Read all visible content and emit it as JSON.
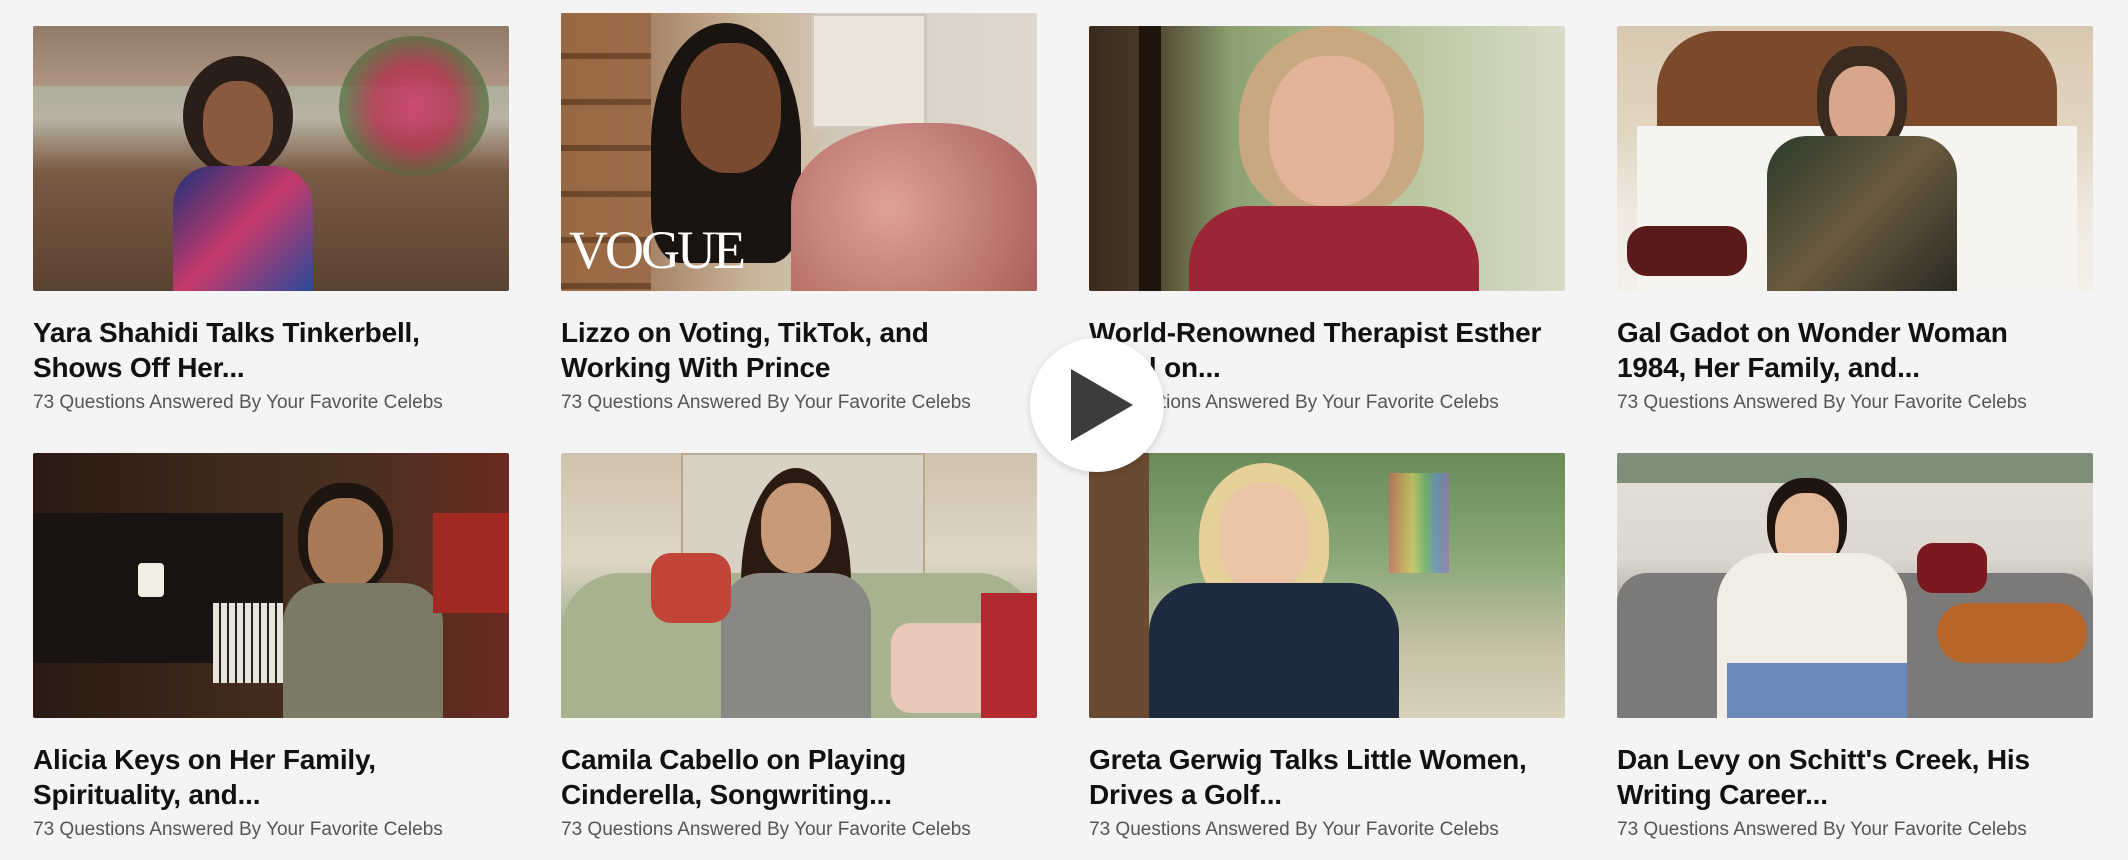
{
  "videos": [
    {
      "title_line1": "Yara Shahidi Talks Tinkerbell,",
      "title_line2": "Shows Off Her...",
      "series": "73 Questions Answered By Your Favorite Celebs"
    },
    {
      "title_line1": "Lizzo on Voting, TikTok, and",
      "title_line2": "Working With Prince",
      "series": "73 Questions Answered By Your Favorite Celebs",
      "brand": "VOGUE"
    },
    {
      "title_line1": "World-Renowned Therapist Esther",
      "title_line2": "Perel on...",
      "series": "73 Questions Answered By Your Favorite Celebs"
    },
    {
      "title_line1": "Gal Gadot on Wonder Woman",
      "title_line2": "1984, Her Family, and...",
      "series": "73 Questions Answered By Your Favorite Celebs"
    },
    {
      "title_line1": "Alicia Keys on Her Family,",
      "title_line2": "Spirituality, and...",
      "series": "73 Questions Answered By Your Favorite Celebs"
    },
    {
      "title_line1": "Camila Cabello on Playing",
      "title_line2": "Cinderella, Songwriting...",
      "series": "73 Questions Answered By Your Favorite Celebs"
    },
    {
      "title_line1": "Greta Gerwig Talks Little Women,",
      "title_line2": "Drives a Golf...",
      "series": "73 Questions Answered By Your Favorite Celebs"
    },
    {
      "title_line1": "Dan Levy on Schitt's Creek, His",
      "title_line2": "Writing Career...",
      "series": "73 Questions Answered By Your Favorite Celebs"
    }
  ],
  "play_icon": "play-icon"
}
